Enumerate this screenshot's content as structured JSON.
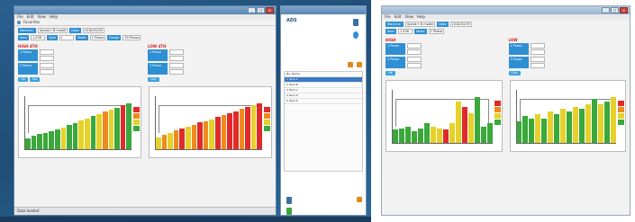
{
  "left_window": {
    "menu": [
      "File",
      "Edit",
      "View",
      "Help"
    ],
    "toolbar_text": "Favorites",
    "header": {
      "label1": "Machine",
      "value1": "Speak+ B model",
      "label2": "Date",
      "value2": "2018/01/09"
    },
    "row1": [
      {
        "label": "Item",
        "value": "1,036"
      },
      {
        "label": "Type",
        "value": "L"
      },
      {
        "label": "Mode",
        "value": "1 Phase"
      },
      {
        "label": "Range",
        "value": "50 Phase"
      }
    ],
    "section_left": "HIGH 4TH",
    "section_right": "LOW 4TH",
    "blocks": [
      "1 Phase",
      "2 Phase",
      "3 Phase"
    ],
    "buttons": [
      "OK",
      "Set",
      "Calc"
    ],
    "statusbar": "Data loaded"
  },
  "right_window": {
    "menu": [
      "File",
      "Edit",
      "View",
      "Help"
    ],
    "section_left": "HIGH",
    "section_right": "LOW"
  },
  "panel": {
    "logo": "ADS",
    "rows": [
      "No.  Name",
      "1   Item A",
      "2   Item B",
      "3   Item C",
      "4   Item D",
      "5   Item E"
    ]
  },
  "colors": {
    "accent": "#2f8fd3",
    "red": "#e02a2a",
    "green": "#3aa83a",
    "yellow": "#e6d12a",
    "orange": "#f08a1e"
  },
  "chart_data": [
    {
      "type": "bar",
      "title": "",
      "values": [
        10,
        12,
        14,
        15,
        16,
        18,
        20,
        22,
        24,
        26,
        28,
        30,
        32,
        34,
        36,
        38,
        40,
        42
      ],
      "colors_seq": [
        "#3aa83a",
        "#3aa83a",
        "#3aa83a",
        "#3aa83a",
        "#3aa83a",
        "#3aa83a",
        "#e6d12a",
        "#3aa83a",
        "#3aa83a",
        "#e6d12a",
        "#e6d12a",
        "#3aa83a",
        "#e6d12a",
        "#f08a1e",
        "#e6d12a",
        "#3aa83a",
        "#e02a2a",
        "#3aa83a"
      ]
    },
    {
      "type": "bar",
      "title": "",
      "values": [
        15,
        18,
        20,
        23,
        26,
        28,
        30,
        33,
        35,
        37,
        40,
        42,
        45,
        47,
        50,
        52,
        55,
        57
      ],
      "colors_seq": [
        "#e6d12a",
        "#f08a1e",
        "#e6d12a",
        "#f08a1e",
        "#e02a2a",
        "#e6d12a",
        "#f08a1e",
        "#e02a2a",
        "#f08a1e",
        "#e6d12a",
        "#e02a2a",
        "#f08a1e",
        "#e02a2a",
        "#e02a2a",
        "#f08a1e",
        "#e02a2a",
        "#e6d12a",
        "#e02a2a"
      ]
    },
    {
      "type": "bar",
      "title": "",
      "values": [
        8,
        9,
        10,
        7,
        9,
        12,
        10,
        9,
        8,
        12,
        25,
        22,
        18,
        28,
        10,
        12
      ],
      "colors_seq": [
        "#3aa83a",
        "#3aa83a",
        "#3aa83a",
        "#3aa83a",
        "#3aa83a",
        "#3aa83a",
        "#e6d12a",
        "#e6d12a",
        "#e02a2a",
        "#e6d12a",
        "#e6d12a",
        "#e02a2a",
        "#e6d12a",
        "#3aa83a",
        "#3aa83a",
        "#3aa83a"
      ]
    },
    {
      "type": "bar",
      "title": "",
      "values": [
        9,
        11,
        10,
        12,
        10,
        13,
        12,
        14,
        13,
        15,
        14,
        16,
        18,
        16,
        17,
        19
      ],
      "colors_seq": [
        "#3aa83a",
        "#3aa83a",
        "#3aa83a",
        "#e6d12a",
        "#3aa83a",
        "#e6d12a",
        "#3aa83a",
        "#e6d12a",
        "#3aa83a",
        "#e6d12a",
        "#3aa83a",
        "#e6d12a",
        "#3aa83a",
        "#e6d12a",
        "#3aa83a",
        "#e6d12a"
      ]
    }
  ]
}
